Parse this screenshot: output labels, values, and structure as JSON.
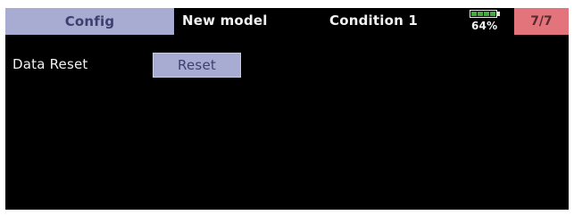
{
  "header": {
    "tab_label": "Config",
    "model_name": "New model",
    "condition": "Condition 1",
    "battery": {
      "percent_text": "64%",
      "level_fraction": 0.64,
      "icon": "battery-icon",
      "color": "#3fae3a"
    },
    "page": "7/7"
  },
  "main": {
    "data_reset": {
      "label": "Data Reset",
      "button_label": "Reset"
    }
  },
  "colors": {
    "background": "#000000",
    "tab_bg": "#a9acd2",
    "page_bg": "#e3747c",
    "text": "#f2f2f2"
  }
}
